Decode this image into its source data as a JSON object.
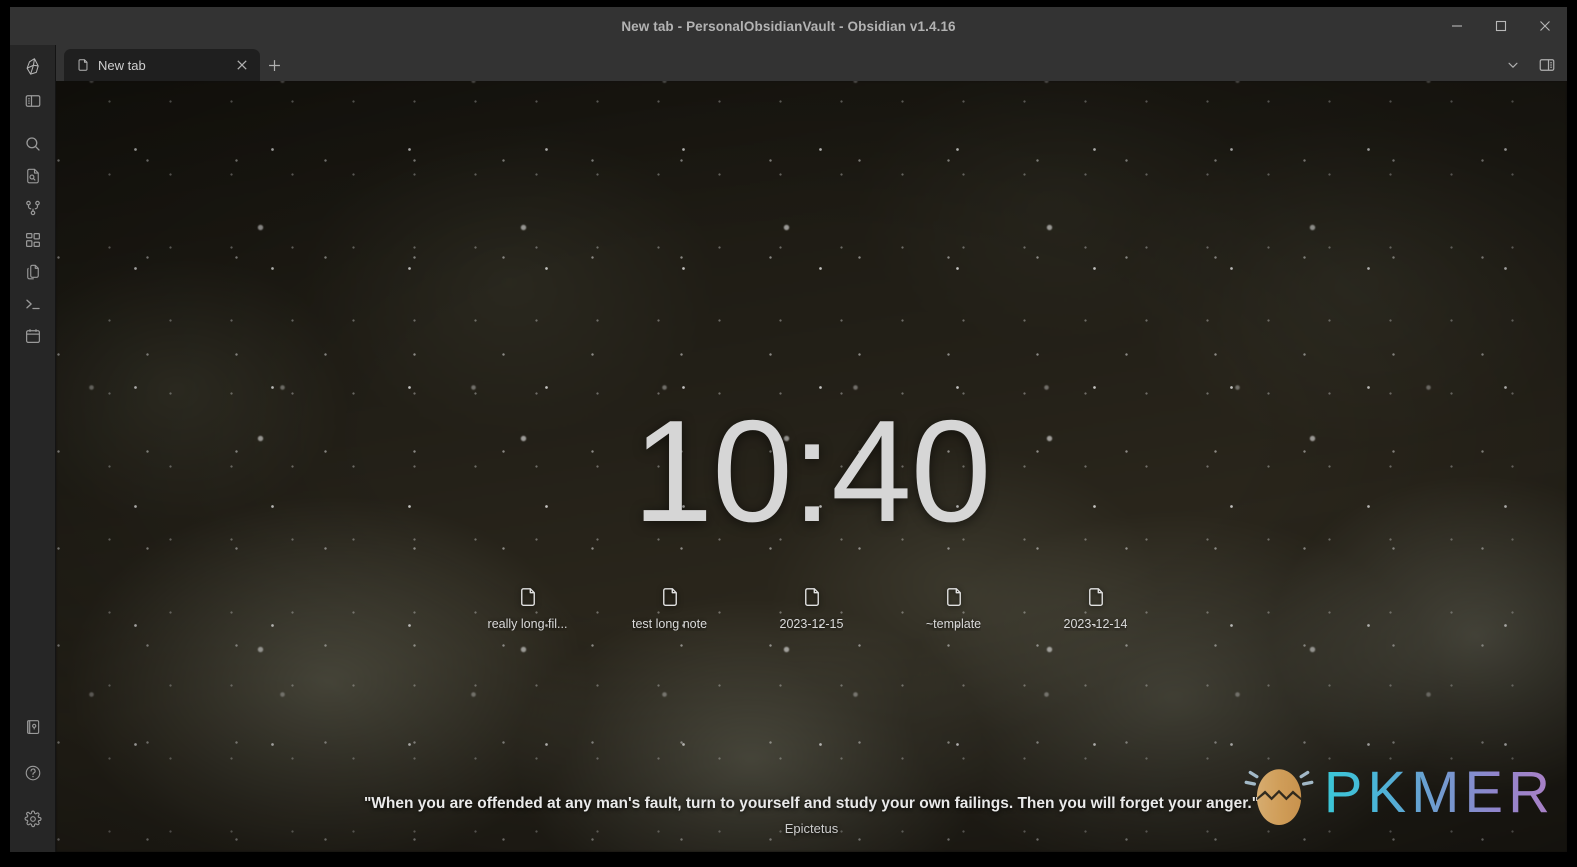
{
  "window": {
    "title": "New tab - PersonalObsidianVault - Obsidian v1.4.16",
    "app_name": "Obsidian",
    "version": "v1.4.16",
    "vault_name": "PersonalObsidianVault",
    "controls": {
      "minimize": "minimize-button",
      "maximize": "maximize-button",
      "close": "close-button"
    }
  },
  "ribbon": {
    "logo": "obsidian-logo",
    "toggle_left_sidebar": "toggle-left-sidebar",
    "items": [
      {
        "name": "search",
        "icon": "search-icon",
        "tooltip": "Search"
      },
      {
        "name": "search-in-file",
        "icon": "file-search-icon",
        "tooltip": "Search in file"
      },
      {
        "name": "graph-view",
        "icon": "graph-icon",
        "tooltip": "Open graph view"
      },
      {
        "name": "canvas",
        "icon": "grid-icon",
        "tooltip": "Create new canvas"
      },
      {
        "name": "copy",
        "icon": "copy-files-icon",
        "tooltip": "Copy"
      },
      {
        "name": "terminal",
        "icon": "terminal-icon",
        "tooltip": "Terminal"
      },
      {
        "name": "calendar",
        "icon": "calendar-icon",
        "tooltip": "Calendar"
      }
    ],
    "bottom_items": [
      {
        "name": "open-another-vault",
        "icon": "vault-icon",
        "tooltip": "Open another vault"
      },
      {
        "name": "help",
        "icon": "help-icon",
        "tooltip": "Help"
      },
      {
        "name": "settings",
        "icon": "gear-icon",
        "tooltip": "Settings"
      }
    ]
  },
  "tabbar": {
    "tabs": [
      {
        "label": "New tab",
        "icon": "file-icon",
        "active": true,
        "close": "close-icon"
      }
    ],
    "new_tab": "+",
    "right_controls": [
      {
        "name": "tab-list",
        "icon": "chevron-down-icon"
      },
      {
        "name": "toggle-right-sidebar",
        "icon": "right-sidebar-icon"
      }
    ]
  },
  "newtab": {
    "clock": "10:40",
    "recent_files": [
      {
        "label": "really long fil...",
        "icon": "file-icon"
      },
      {
        "label": "test long note",
        "icon": "file-icon"
      },
      {
        "label": "2023-12-15",
        "icon": "file-icon"
      },
      {
        "label": "~template",
        "icon": "file-icon"
      },
      {
        "label": "2023-12-14",
        "icon": "file-icon"
      }
    ],
    "quote": {
      "text": "\"When you are offended at any man's fault, turn to yourself and study your own failings. Then you will forget your anger.\"",
      "author": "Epictetus"
    },
    "watermark": {
      "text": "PKMER",
      "logo": "pkmer-egg-logo"
    }
  },
  "colors": {
    "window_bg": "#1e1e1e",
    "titlebar_bg": "#333333",
    "ribbon_bg": "#262626",
    "tab_active_bg": "#1f1f1f",
    "text_primary": "#dcdcdc",
    "text_muted": "#9a9a9a",
    "watermark_gradient_start": "#3dd6e8",
    "watermark_gradient_end": "#b98ad6",
    "egg_color": "#e0ad6a"
  }
}
